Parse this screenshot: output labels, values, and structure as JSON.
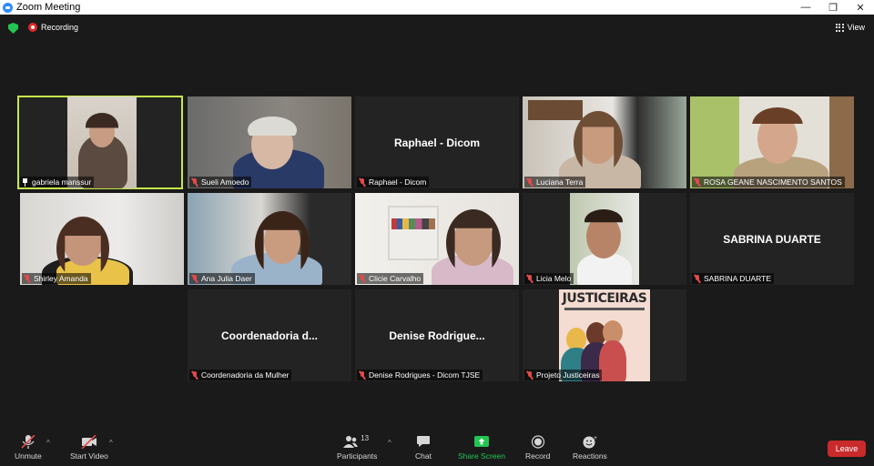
{
  "window": {
    "title": "Zoom Meeting",
    "minimize": "—",
    "restore": "❐",
    "close": "✕"
  },
  "topbar": {
    "recording_label": "Recording",
    "view_label": "View"
  },
  "participants": [
    {
      "name": "gabriela manssur",
      "pinned": true,
      "video": true
    },
    {
      "name": "Sueli Amoedo",
      "video": true
    },
    {
      "name": "Raphael - Dicom",
      "display": "Raphael - Dicom",
      "video": false
    },
    {
      "name": "Luciana Terra",
      "video": true
    },
    {
      "name": "ROSA GEANE NASCIMENTO SANTOS",
      "video": true
    },
    {
      "name": "Shirley Amanda",
      "video": true
    },
    {
      "name": "Ana Julia Daer",
      "video": true
    },
    {
      "name": "Clicie Carvalho",
      "video": true
    },
    {
      "name": "Licia Melo",
      "video": true
    },
    {
      "name": "SABRINA DUARTE",
      "display": "SABRINA DUARTE",
      "video": false
    },
    {
      "name": "Coordenadoria da Mulher",
      "display": "Coordenadoria d...",
      "video": false
    },
    {
      "name": "Denise Rodrigues - Dicom TJSE",
      "display": "Denise  Rodrigue...",
      "video": false
    },
    {
      "name": "Projeto Justiceiras",
      "poster_title": "JUSTICEIRAS",
      "video": true
    }
  ],
  "toolbar": {
    "unmute": "Unmute",
    "start_video": "Start Video",
    "participants": "Participants",
    "participants_count": "13",
    "chat": "Chat",
    "share_screen": "Share Screen",
    "record": "Record",
    "reactions": "Reactions",
    "leave": "Leave"
  },
  "colors": {
    "active_speaker": "#c6e84a",
    "share_green": "#23c552",
    "leave_red": "#c92a2a",
    "muted_red": "#e24a4a"
  }
}
